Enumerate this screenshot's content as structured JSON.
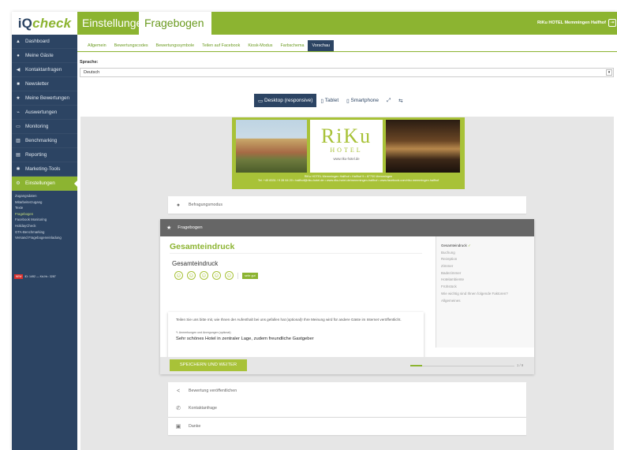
{
  "brand": {
    "logo_part1": "iQ",
    "logo_part2": "check"
  },
  "sidebar": {
    "items": [
      {
        "icon": "▲",
        "label": "Dashboard"
      },
      {
        "icon": "●",
        "label": "Meine Gäste"
      },
      {
        "icon": "◀",
        "label": "Kontaktanfragen"
      },
      {
        "icon": "■",
        "label": "Newsletter"
      },
      {
        "icon": "★",
        "label": "Meine Bewertungen"
      },
      {
        "icon": "⌁",
        "label": "Auswertungen"
      },
      {
        "icon": "▭",
        "label": "Monitoring"
      },
      {
        "icon": "▥",
        "label": "Benchmarking"
      },
      {
        "icon": "▤",
        "label": "Reporting"
      },
      {
        "icon": "✱",
        "label": "Marketing-Tools"
      },
      {
        "icon": "⚙",
        "label": "Einstellungen"
      }
    ],
    "subitems": [
      "Zugangsdaten",
      "Mitarbeiterzugang",
      "Texte",
      "Fragebogen",
      "Facebook Monitoring",
      "HolidayCheck",
      "GTA-Benchmarking",
      "Versand Fragebogeneinladung"
    ],
    "footer_badge": "NEW",
    "footer_text": "ID: 1492 — Kd-Nr.: 3287"
  },
  "header": {
    "title": "Einstellungen",
    "active_tab": "Fragebogen",
    "hotel": "RiKu HOTEL Memmingen Halfhof",
    "logout_icon": "⇥"
  },
  "tabs": [
    "Allgemein",
    "Bewertungscodes",
    "Bewertungssymbole",
    "Teilen auf Facebook",
    "Kiosk-Modus",
    "Farbschema",
    "Vorschau"
  ],
  "language": {
    "label": "Sprache:",
    "value": "Deutsch"
  },
  "devicebar": {
    "desktop": "Desktop (responsive)",
    "tablet": "Tablet",
    "smartphone": "Smartphone",
    "desktop_icon": "▭",
    "tablet_icon": "▯",
    "smartphone_icon": "▯",
    "expand_icon": "⤢",
    "rotate_icon": "⇆"
  },
  "banner": {
    "logo": "RiKu",
    "hotel": "HOTEL",
    "website": "www.riku-hotel.de",
    "address_line1": "RiKu HOTEL Memmingen Halfhof • Halfhof 9 • 87700 Memmingen",
    "address_line2": "Tel. +49 8331 / 9 28 64 20 • halfhof@riku-hotel.de • www.riku-hotel.de/memmingen-halfhof • www.facebook.com/riku.memmingen.halfhof"
  },
  "rows": {
    "top": {
      "icon": "person-icon",
      "glyph": "👤",
      "label": "Befragungsmodus"
    },
    "bottom": [
      {
        "icon": "share-icon",
        "glyph": "<",
        "label": "Bewertung veröffentlichen"
      },
      {
        "icon": "phone-icon",
        "glyph": "✆",
        "label": "Kontaktanfrage"
      },
      {
        "icon": "gift-icon",
        "glyph": "▣",
        "label": "Danke"
      }
    ]
  },
  "fragebogen": {
    "header": "Fragebogen",
    "section_title": "Gesamteindruck",
    "question": "Gesamteindruck",
    "rating_label": "sehr gut",
    "comment_prompt": "Teilen Sie uns bitte mit, wie Ihnen der Aufenthalt bei uns gefallen hat (optional)! Ihre Meinung wird für andere Gäste im Internet veröffentlicht.",
    "comment_note": "✎ Anmerkungen und Anregungen (optional)",
    "comment_value": "Sehr schönes Hotel in zentraler Lage, zudem freundliche Gastgeber",
    "sections": [
      "Gesamteindruck",
      "Buchung",
      "Rezeption",
      "Zimmer",
      "Badezimmer",
      "Hotelambiente",
      "Frühstück",
      "Wie wichtig sind Ihnen folgende Faktoren?",
      "Allgemeines"
    ],
    "sections_active": 0,
    "check_icon": "✓",
    "save_label": "SPEICHERN UND WEITER",
    "progress_fraction": 0.1111,
    "page_label": "1 / 9"
  },
  "colors": {
    "brand_green": "#8cb431",
    "navy": "#2c4463",
    "banner_green": "#a8c238"
  }
}
